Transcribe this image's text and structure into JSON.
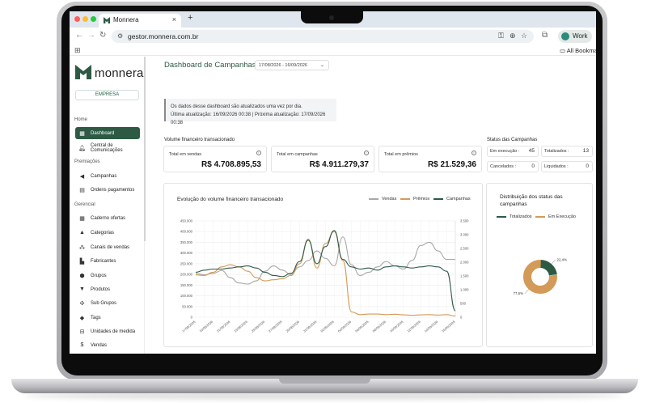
{
  "browser": {
    "tab_title": "Monnera",
    "new_tab": "+",
    "url": "gestor.monnera.com.br",
    "profile": "Work",
    "bookmarks": "All Bookmarks"
  },
  "sidebar": {
    "brand": "monnera",
    "company_button": "EMPRESA",
    "sections": {
      "home": "Home",
      "rewards": "Premiações",
      "management": "Gerencial"
    },
    "items": [
      {
        "label": "Dashboard",
        "icon": "grid-icon"
      },
      {
        "label": "Central de Comunicações",
        "icon": "bell-icon"
      },
      {
        "label": "Campanhas",
        "icon": "megaphone-icon"
      },
      {
        "label": "Ordens pagamentos",
        "icon": "payments-icon"
      },
      {
        "label": "Caderno ofertas",
        "icon": "table-icon"
      },
      {
        "label": "Categorias",
        "icon": "shapes-icon"
      },
      {
        "label": "Canais de vendas",
        "icon": "channels-icon"
      },
      {
        "label": "Fabricantes",
        "icon": "factory-icon"
      },
      {
        "label": "Grupos",
        "icon": "box-icon"
      },
      {
        "label": "Produtos",
        "icon": "basket-icon"
      },
      {
        "label": "Sub Grupos",
        "icon": "network-icon"
      },
      {
        "label": "Tags",
        "icon": "tag-icon"
      },
      {
        "label": "Unidades de medida",
        "icon": "ruler-icon"
      },
      {
        "label": "Vendas",
        "icon": "dollar-icon"
      }
    ]
  },
  "header": {
    "title": "Dashboard de Campanhas",
    "date_range": "17/08/2026 - 16/09/2026"
  },
  "notice": {
    "line1": "Os dados desse dashboard são atualizados uma vez por dia.",
    "line2": "Última atualização: 16/09/2026 00:38 | Próxima atualização: 17/09/2026 00:38"
  },
  "financial": {
    "section_label": "Volume financeiro transacionado",
    "cards": [
      {
        "title": "Total em vendas",
        "value": "R$ 4.708.895,53"
      },
      {
        "title": "Total em campanhas",
        "value": "R$ 4.911.279,37"
      },
      {
        "title": "Total em prêmios",
        "value": "R$ 21.529,36"
      }
    ]
  },
  "status": {
    "section_label": "Status das Campanhas",
    "items": [
      {
        "label": "Em execução :",
        "value": "45"
      },
      {
        "label": "Totalizados :",
        "value": "13"
      },
      {
        "label": "Cancelados :",
        "value": "0"
      },
      {
        "label": "Liquidados :",
        "value": "0"
      }
    ]
  },
  "colors": {
    "primary": "#2e5a45",
    "vendas": "#a8a8a8",
    "premios": "#d49a57",
    "campanhas": "#2e5a45"
  },
  "chart_data": [
    {
      "type": "line",
      "title": "Evolução do volume financeiro transacionado",
      "x": [
        "17/08/2026",
        "18/08/2026",
        "19/08/2026",
        "20/08/2026",
        "21/08/2026",
        "22/08/2026",
        "23/08/2026",
        "24/08/2026",
        "25/08/2026",
        "26/08/2026",
        "27/08/2026",
        "28/08/2026",
        "29/08/2026",
        "30/08/2026",
        "31/08/2026",
        "01/09/2026",
        "02/09/2026",
        "03/09/2026",
        "04/09/2026",
        "05/09/2026",
        "06/09/2026",
        "07/09/2026",
        "08/09/2026",
        "09/09/2026",
        "10/09/2026",
        "11/09/2026",
        "12/09/2026",
        "13/09/2026",
        "14/09/2026",
        "15/09/2026",
        "16/09/2026"
      ],
      "y_left_ticks": [
        "0",
        "50.000",
        "100.000",
        "150.000",
        "200.000",
        "250.000",
        "300.000",
        "350.000",
        "400.000",
        "450.000"
      ],
      "y_right_ticks": [
        "0",
        "500",
        "1.000",
        "1.500",
        "2.000",
        "2.500",
        "3.000",
        "3.500"
      ],
      "ylim_left": [
        0,
        450000
      ],
      "ylim_right": [
        0,
        3500
      ],
      "series": [
        {
          "name": "Vendas",
          "axis": "left",
          "values": [
            205000,
            198000,
            205000,
            218000,
            185000,
            160000,
            155000,
            170000,
            215000,
            240000,
            220000,
            200000,
            235000,
            265000,
            310000,
            275000,
            240000,
            375000,
            245000,
            195000,
            210000,
            235000,
            260000,
            240000,
            225000,
            265000,
            335000,
            350000,
            310000,
            270000,
            270000
          ]
        },
        {
          "name": "Prêmios",
          "axis": "left",
          "values": [
            198000,
            195000,
            210000,
            235000,
            245000,
            235000,
            215000,
            185000,
            170000,
            175000,
            180000,
            195000,
            250000,
            365000,
            230000,
            345000,
            400000,
            265000,
            25000,
            12000,
            15000,
            15000,
            12000,
            14000,
            11000,
            9000,
            11000,
            12000,
            10000,
            12000,
            6000
          ]
        },
        {
          "name": "Campanhas",
          "axis": "left",
          "values": [
            210000,
            220000,
            225000,
            225000,
            230000,
            235000,
            240000,
            230000,
            210000,
            195000,
            190000,
            205000,
            260000,
            360000,
            250000,
            330000,
            405000,
            270000,
            235000,
            225000,
            230000,
            220000,
            235000,
            240000,
            235000,
            230000,
            235000,
            240000,
            235000,
            215000,
            30000
          ]
        }
      ]
    },
    {
      "type": "pie",
      "title": "Distribuição dos status das campanhas",
      "series": [
        {
          "name": "Totalizados",
          "value": 22.4,
          "label": "22,4%"
        },
        {
          "name": "Em Execução",
          "value": 77.6,
          "label": "77,6%"
        }
      ]
    }
  ]
}
